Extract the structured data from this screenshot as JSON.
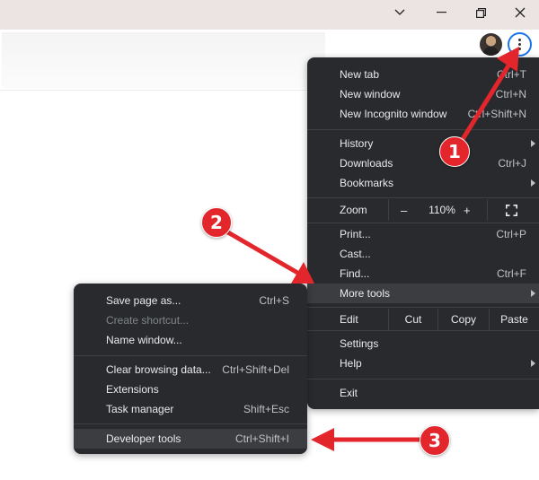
{
  "window_controls": {
    "tab_search": "chevron-down-icon",
    "minimize": "minimize-icon",
    "restore": "restore-icon",
    "close": "close-icon"
  },
  "toolbar": {
    "profile": "avatar",
    "menu_button": "more-vert-icon",
    "accent_color": "#1a73e8"
  },
  "main_menu": {
    "new_tab": {
      "label": "New tab",
      "shortcut": "Ctrl+T"
    },
    "new_window": {
      "label": "New window",
      "shortcut": "Ctrl+N"
    },
    "new_incognito": {
      "label": "New Incognito window",
      "shortcut": "Ctrl+Shift+N"
    },
    "history": {
      "label": "History"
    },
    "downloads": {
      "label": "Downloads",
      "shortcut": "Ctrl+J"
    },
    "bookmarks": {
      "label": "Bookmarks"
    },
    "zoom": {
      "label": "Zoom",
      "minus": "–",
      "value": "110%",
      "plus": "+"
    },
    "print": {
      "label": "Print...",
      "shortcut": "Ctrl+P"
    },
    "cast": {
      "label": "Cast..."
    },
    "find": {
      "label": "Find...",
      "shortcut": "Ctrl+F"
    },
    "more_tools": {
      "label": "More tools"
    },
    "edit": {
      "label": "Edit",
      "cut": "Cut",
      "copy": "Copy",
      "paste": "Paste"
    },
    "settings": {
      "label": "Settings"
    },
    "help": {
      "label": "Help"
    },
    "exit": {
      "label": "Exit"
    }
  },
  "more_tools_menu": {
    "save_page": {
      "label": "Save page as...",
      "shortcut": "Ctrl+S"
    },
    "create_shortcut": {
      "label": "Create shortcut..."
    },
    "name_window": {
      "label": "Name window..."
    },
    "clear_browsing": {
      "label": "Clear browsing data...",
      "shortcut": "Ctrl+Shift+Del"
    },
    "extensions": {
      "label": "Extensions"
    },
    "task_manager": {
      "label": "Task manager",
      "shortcut": "Shift+Esc"
    },
    "developer_tools": {
      "label": "Developer tools",
      "shortcut": "Ctrl+Shift+I"
    }
  },
  "annotations": {
    "step_1": "1",
    "step_2": "2",
    "step_3": "3",
    "arrow_color": "#e3262c"
  }
}
